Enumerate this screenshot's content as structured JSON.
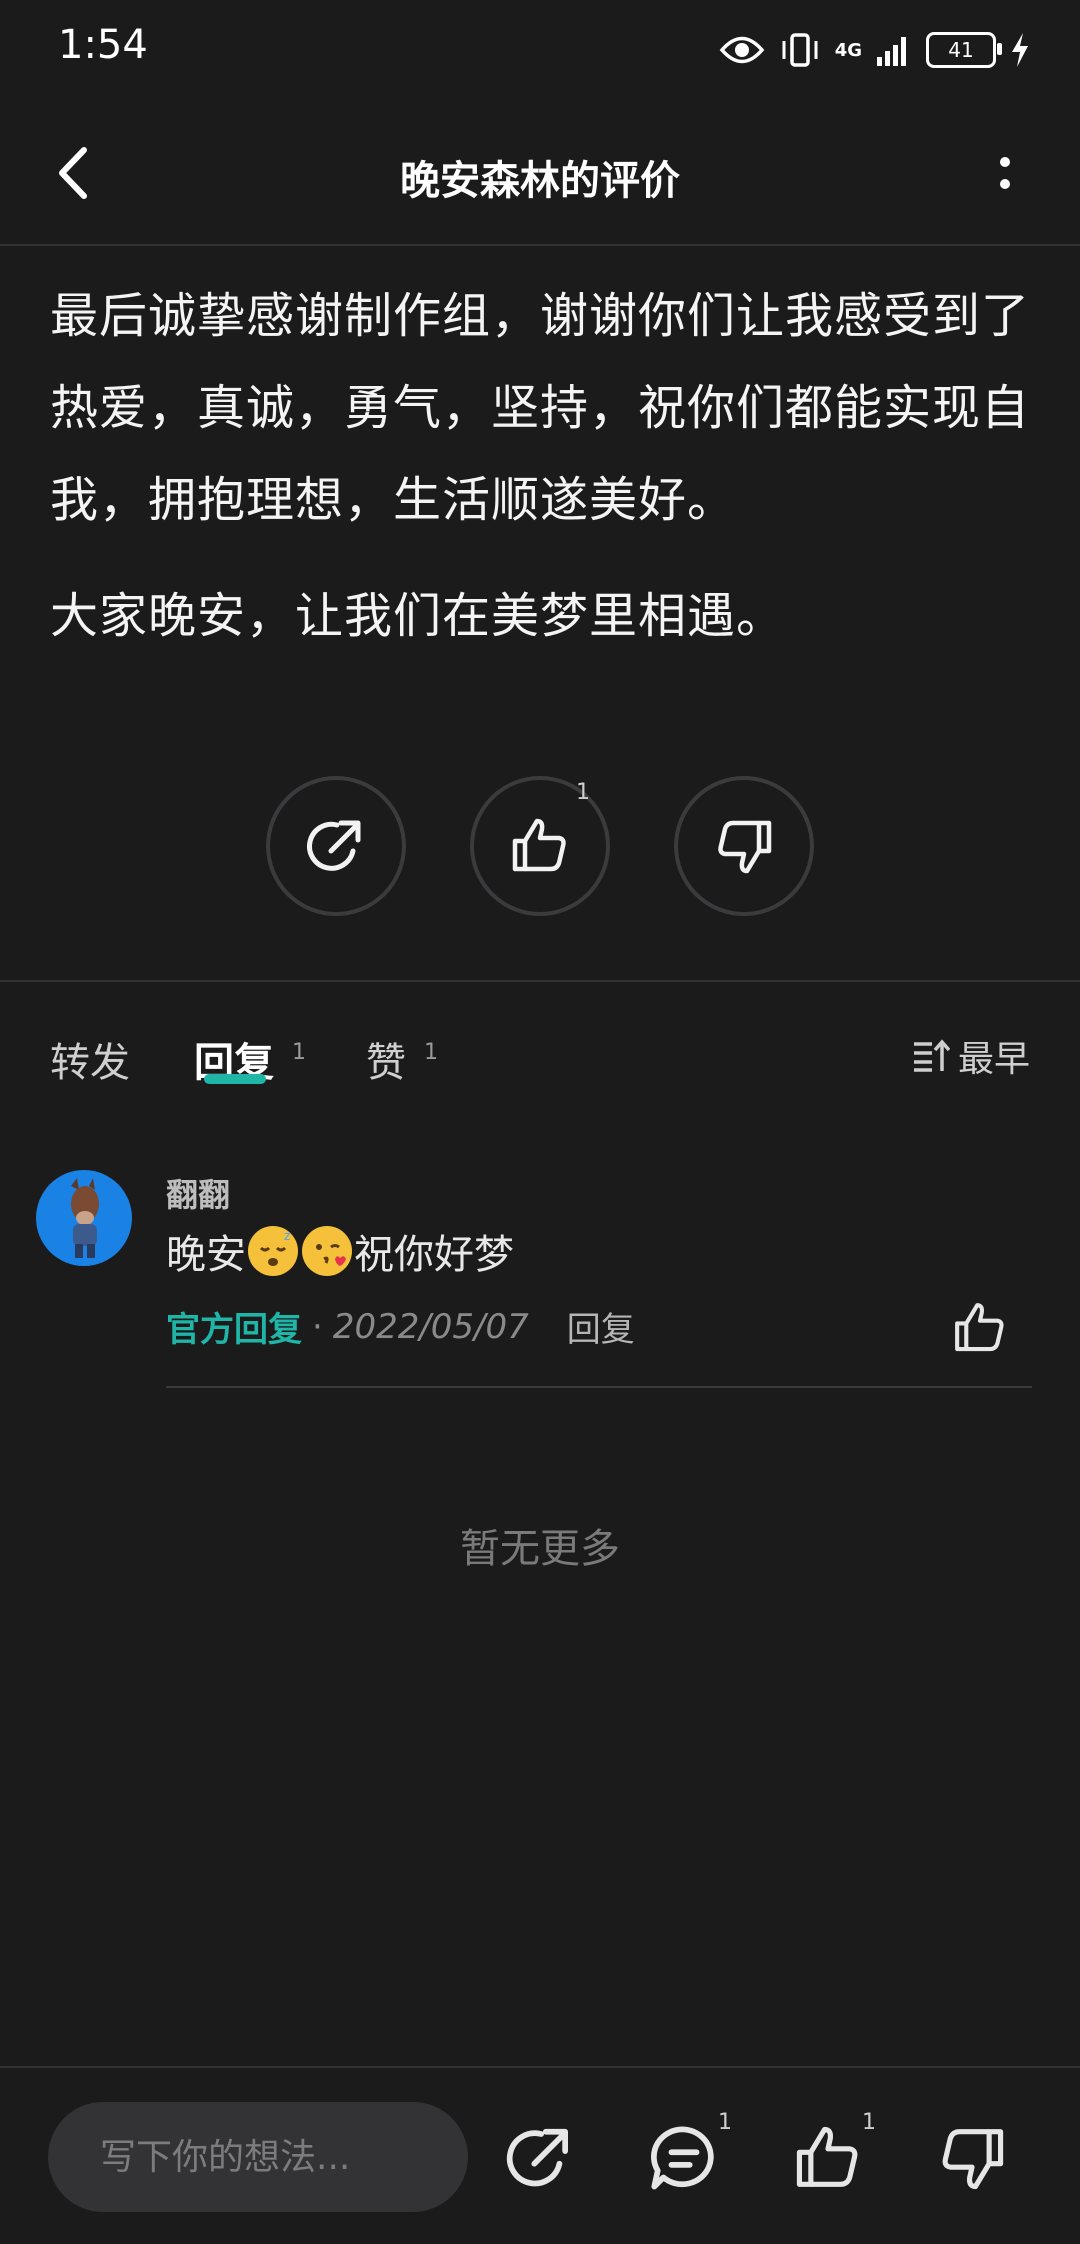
{
  "status_bar": {
    "time": "1:54",
    "network": "4G",
    "battery": "41"
  },
  "header": {
    "title": "晚安森林的评价"
  },
  "review": {
    "paragraphs": [
      "最后诚挚感谢制作组，谢谢你们让我感受到了热爱，真诚，勇气，坚持，祝你们都能实现自我，拥抱理想，生活顺遂美好。",
      "大家晚安，让我们在美梦里相遇。"
    ]
  },
  "actions": {
    "like_count": "1"
  },
  "tabs": {
    "forward": "转发",
    "reply": "回复",
    "reply_count": "1",
    "like": "赞",
    "like_count": "1",
    "sort": "最早"
  },
  "comment": {
    "username": "翻翻",
    "text_before": "晚安",
    "text_after": "祝你好梦",
    "official_label": "官方回复",
    "date": "2022/05/07",
    "reply_label": "回复"
  },
  "footer_note": "暂无更多",
  "bottom_bar": {
    "input_placeholder": "写下你的想法...",
    "comment_count": "1",
    "like_count": "1"
  },
  "colors": {
    "background": "#1b1b1c",
    "accent": "#1fb5a7",
    "avatar": "#1a82e4"
  }
}
